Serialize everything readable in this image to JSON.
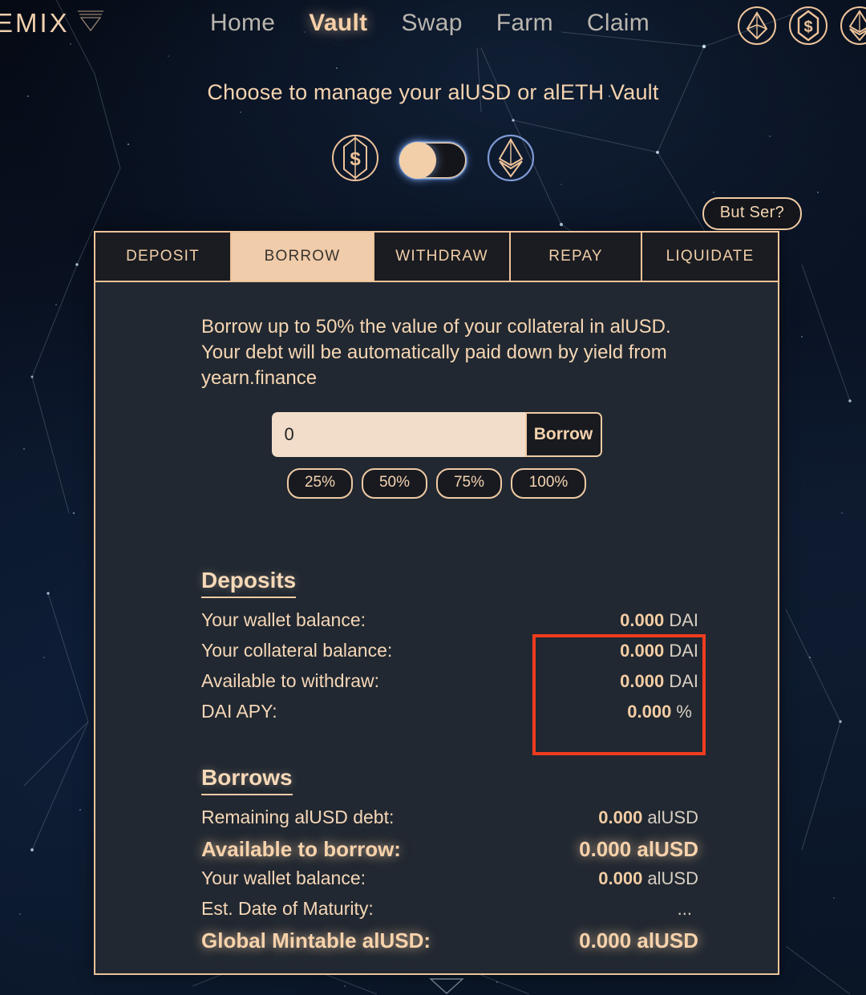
{
  "brand": {
    "logo_text": "EMIX",
    "logo_icon": "alchemix-triangle-icon"
  },
  "nav": {
    "links": [
      {
        "label": "Home",
        "active": false
      },
      {
        "label": "Vault",
        "active": true
      },
      {
        "label": "Swap",
        "active": false
      },
      {
        "label": "Farm",
        "active": false
      },
      {
        "label": "Claim",
        "active": false
      }
    ],
    "icons": [
      "alcx-token-icon",
      "alusd-token-icon",
      "aleth-token-icon"
    ]
  },
  "header": {
    "subtitle": "Choose to manage your alUSD or alETH Vault"
  },
  "vault_toggle": {
    "left_icon": "alusd-token-icon",
    "right_icon": "aleth-token-icon",
    "state": "alUSD",
    "knob_position": "left"
  },
  "but_ser": {
    "label": "But Ser?"
  },
  "tabs": [
    {
      "label": "DEPOSIT",
      "active": false
    },
    {
      "label": "BORROW",
      "active": true
    },
    {
      "label": "WITHDRAW",
      "active": false
    },
    {
      "label": "REPAY",
      "active": false
    },
    {
      "label": "LIQUIDATE",
      "active": false
    }
  ],
  "panel": {
    "description": "Borrow up to 50% the value of your collateral in alUSD. Your debt will be automatically paid down by yield from yearn.finance",
    "input": {
      "value": "0",
      "placeholder": "0"
    },
    "action_button": "Borrow",
    "percent_buttons": [
      "25%",
      "50%",
      "75%",
      "100%"
    ]
  },
  "deposits": {
    "title": "Deposits",
    "rows": [
      {
        "label": "Your wallet balance:",
        "amount": "0.000",
        "unit": " DAI"
      },
      {
        "label": "Your collateral balance:",
        "amount": "0.000",
        "unit": " DAI"
      },
      {
        "label": "Available to withdraw:",
        "amount": "0.000",
        "unit": " DAI"
      },
      {
        "label": "DAI APY:",
        "amount": "0.000",
        "unit": " %"
      }
    ]
  },
  "borrows": {
    "title": "Borrows",
    "rows": [
      {
        "label": "Remaining alUSD debt:",
        "amount": "0.000",
        "unit": " alUSD",
        "highlight": false
      },
      {
        "label": "Available to borrow:",
        "amount": "0.000",
        "unit": " alUSD",
        "highlight": true
      },
      {
        "label": "Your wallet balance:",
        "amount": "0.000",
        "unit": " alUSD",
        "highlight": false
      },
      {
        "label": "Est. Date of Maturity:",
        "amount": "",
        "unit": "...",
        "highlight": false
      },
      {
        "label": "Global Mintable alUSD:",
        "amount": "0.000",
        "unit": " alUSD",
        "highlight": true
      }
    ]
  },
  "annotation": {
    "name": "red-highlight-box",
    "color": "#f03c1e"
  },
  "colors": {
    "accent_peach": "#f0cba4",
    "text_peach": "#f6d7b7",
    "card_bg": "#212831",
    "tab_bg": "#1b1c21",
    "tab_active_bg": "#f0ccaa",
    "input_bg": "#f2ddcb",
    "page_bg": "#0a1324",
    "annotation_red": "#f03c1e"
  }
}
